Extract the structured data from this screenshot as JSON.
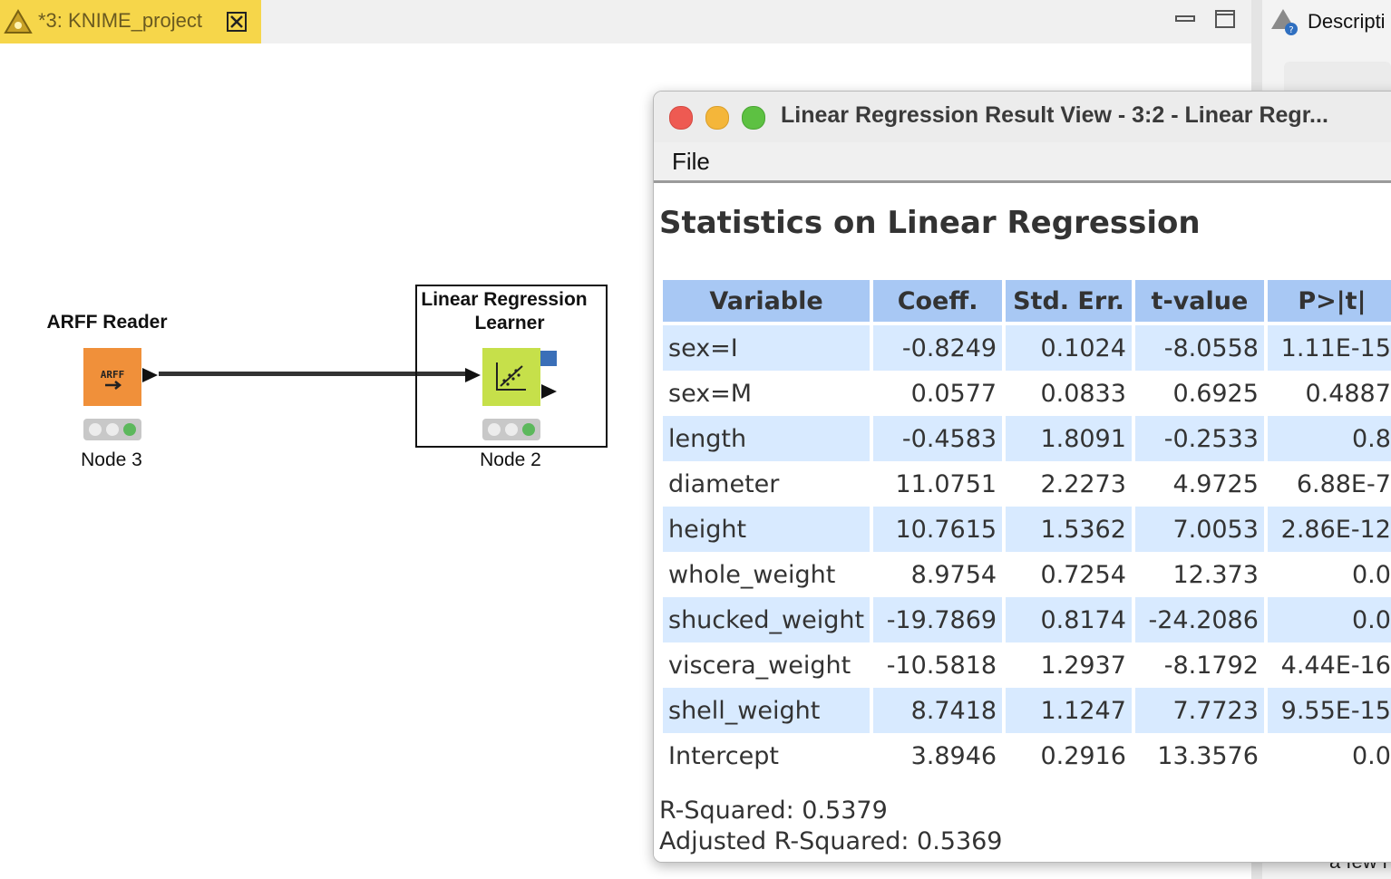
{
  "editor_tab": {
    "title": "*3: KNIME_project"
  },
  "description_panel": {
    "title": "Descripti",
    "footer_text": "a few i"
  },
  "workflow": {
    "nodes": [
      {
        "name": "ARFF Reader",
        "label": "Node 3",
        "icon_text": "ARFF"
      },
      {
        "name_line1": "Linear Regression",
        "name_line2": "Learner",
        "label": "Node 2"
      }
    ]
  },
  "result_window": {
    "title": "Linear Regression Result View - 3:2 - Linear Regr...",
    "menu": {
      "file": "File"
    },
    "heading": "Statistics on Linear Regression",
    "columns": [
      "Variable",
      "Coeff.",
      "Std. Err.",
      "t-value",
      "P>|t|"
    ],
    "rows": [
      [
        "sex=I",
        "-0.8249",
        "0.1024",
        "-8.0558",
        "1.11E-15"
      ],
      [
        "sex=M",
        "0.0577",
        "0.0833",
        "0.6925",
        "0.4887"
      ],
      [
        "length",
        "-0.4583",
        "1.8091",
        "-0.2533",
        "0.8"
      ],
      [
        "diameter",
        "11.0751",
        "2.2273",
        "4.9725",
        "6.88E-7"
      ],
      [
        "height",
        "10.7615",
        "1.5362",
        "7.0053",
        "2.86E-12"
      ],
      [
        "whole_weight",
        "8.9754",
        "0.7254",
        "12.373",
        "0.0"
      ],
      [
        "shucked_weight",
        "-19.7869",
        "0.8174",
        "-24.2086",
        "0.0"
      ],
      [
        "viscera_weight",
        "-10.5818",
        "1.2937",
        "-8.1792",
        "4.44E-16"
      ],
      [
        "shell_weight",
        "8.7418",
        "1.1247",
        "7.7723",
        "9.55E-15"
      ],
      [
        "Intercept",
        "3.8946",
        "0.2916",
        "13.3576",
        "0.0"
      ]
    ],
    "r_squared": "R-Squared: 0.5379",
    "adjusted_r_squared": "Adjusted R-Squared: 0.5369"
  },
  "colors": {
    "tab_active": "#f6d64a",
    "reader_node": "#f0903a",
    "learner_node": "#c6e04a",
    "table_header": "#a8c8f4",
    "table_stripe": "#d8eaff"
  }
}
